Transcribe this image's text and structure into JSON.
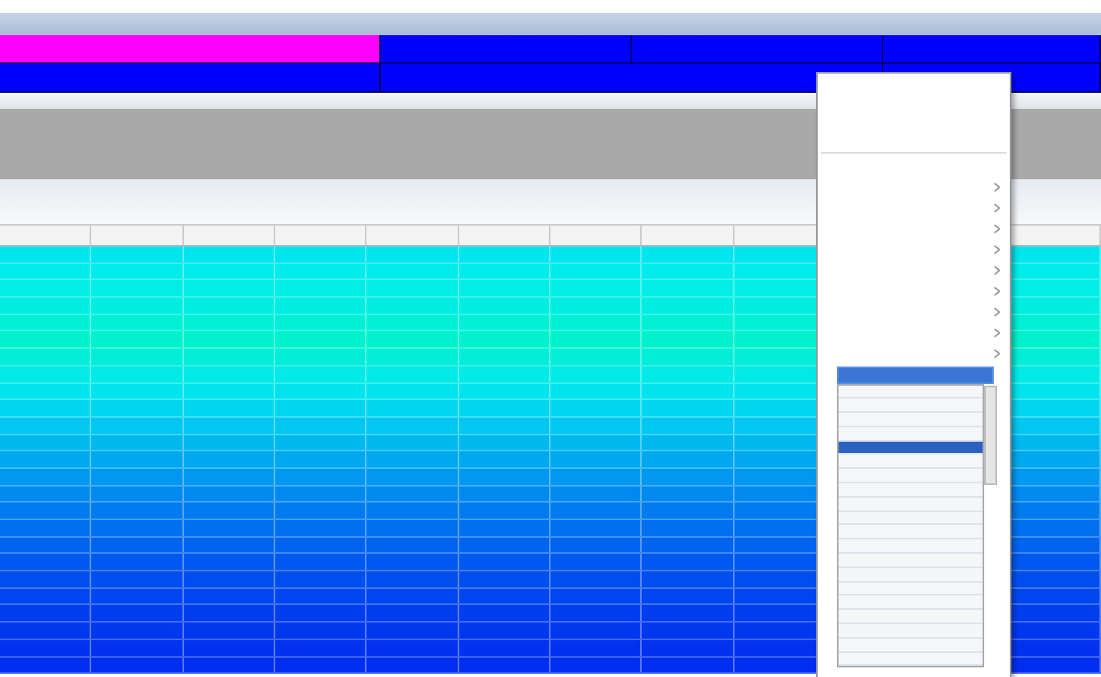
{
  "header_bar": {
    "rows": [
      {
        "cells": [
          {
            "color": "#ff00ff"
          },
          {
            "color": "#0000ff"
          },
          {
            "color": "#0000ff"
          },
          {
            "color": "#0000ff"
          }
        ]
      },
      {
        "cells": [
          {
            "color": "#0000ff"
          },
          {
            "color": "#0000ff"
          },
          {
            "color": "#0000ff"
          }
        ]
      }
    ]
  },
  "table": {
    "rows": [
      {
        "color": "#00e6ee"
      },
      {
        "color": "#00ecea"
      },
      {
        "color": "#00eee6"
      },
      {
        "color": "#00eee0"
      },
      {
        "color": "#00f0d6"
      },
      {
        "color": "#00f2cc"
      },
      {
        "color": "#00eed8"
      },
      {
        "color": "#00eae6"
      },
      {
        "color": "#00e4ee"
      },
      {
        "color": "#00d6f0"
      },
      {
        "color": "#00c8f0"
      },
      {
        "color": "#00b8f0"
      },
      {
        "color": "#00a8f0"
      },
      {
        "color": "#0098f0"
      },
      {
        "color": "#008af0"
      },
      {
        "color": "#007cf0"
      },
      {
        "color": "#0070f0"
      },
      {
        "color": "#0064f0"
      },
      {
        "color": "#0058f0"
      },
      {
        "color": "#004ef0"
      },
      {
        "color": "#0046f0"
      },
      {
        "color": "#003ef0"
      },
      {
        "color": "#0038f0"
      },
      {
        "color": "#0032f0"
      },
      {
        "color": "#002ef0"
      }
    ]
  },
  "context_menu": {
    "items": [
      {
        "kind": "command"
      },
      {
        "kind": "command"
      },
      {
        "kind": "command"
      },
      {
        "kind": "command"
      },
      {
        "kind": "separator"
      },
      {
        "kind": "command"
      },
      {
        "kind": "submenu"
      },
      {
        "kind": "submenu"
      },
      {
        "kind": "submenu"
      },
      {
        "kind": "submenu"
      },
      {
        "kind": "submenu"
      },
      {
        "kind": "submenu"
      },
      {
        "kind": "submenu"
      },
      {
        "kind": "submenu"
      },
      {
        "kind": "submenu"
      }
    ],
    "combo": {
      "selected": true
    },
    "dropdown": {
      "items": [
        {
          "selected": false
        },
        {
          "selected": false
        },
        {
          "selected": false
        },
        {
          "selected": false
        },
        {
          "selected": true
        },
        {
          "selected": false
        },
        {
          "selected": false
        },
        {
          "selected": false
        },
        {
          "selected": false
        },
        {
          "selected": false
        },
        {
          "selected": false
        },
        {
          "selected": false
        },
        {
          "selected": false
        },
        {
          "selected": false
        },
        {
          "selected": false
        },
        {
          "selected": false
        },
        {
          "selected": false
        },
        {
          "selected": false
        },
        {
          "selected": false
        },
        {
          "selected": false
        }
      ]
    }
  }
}
